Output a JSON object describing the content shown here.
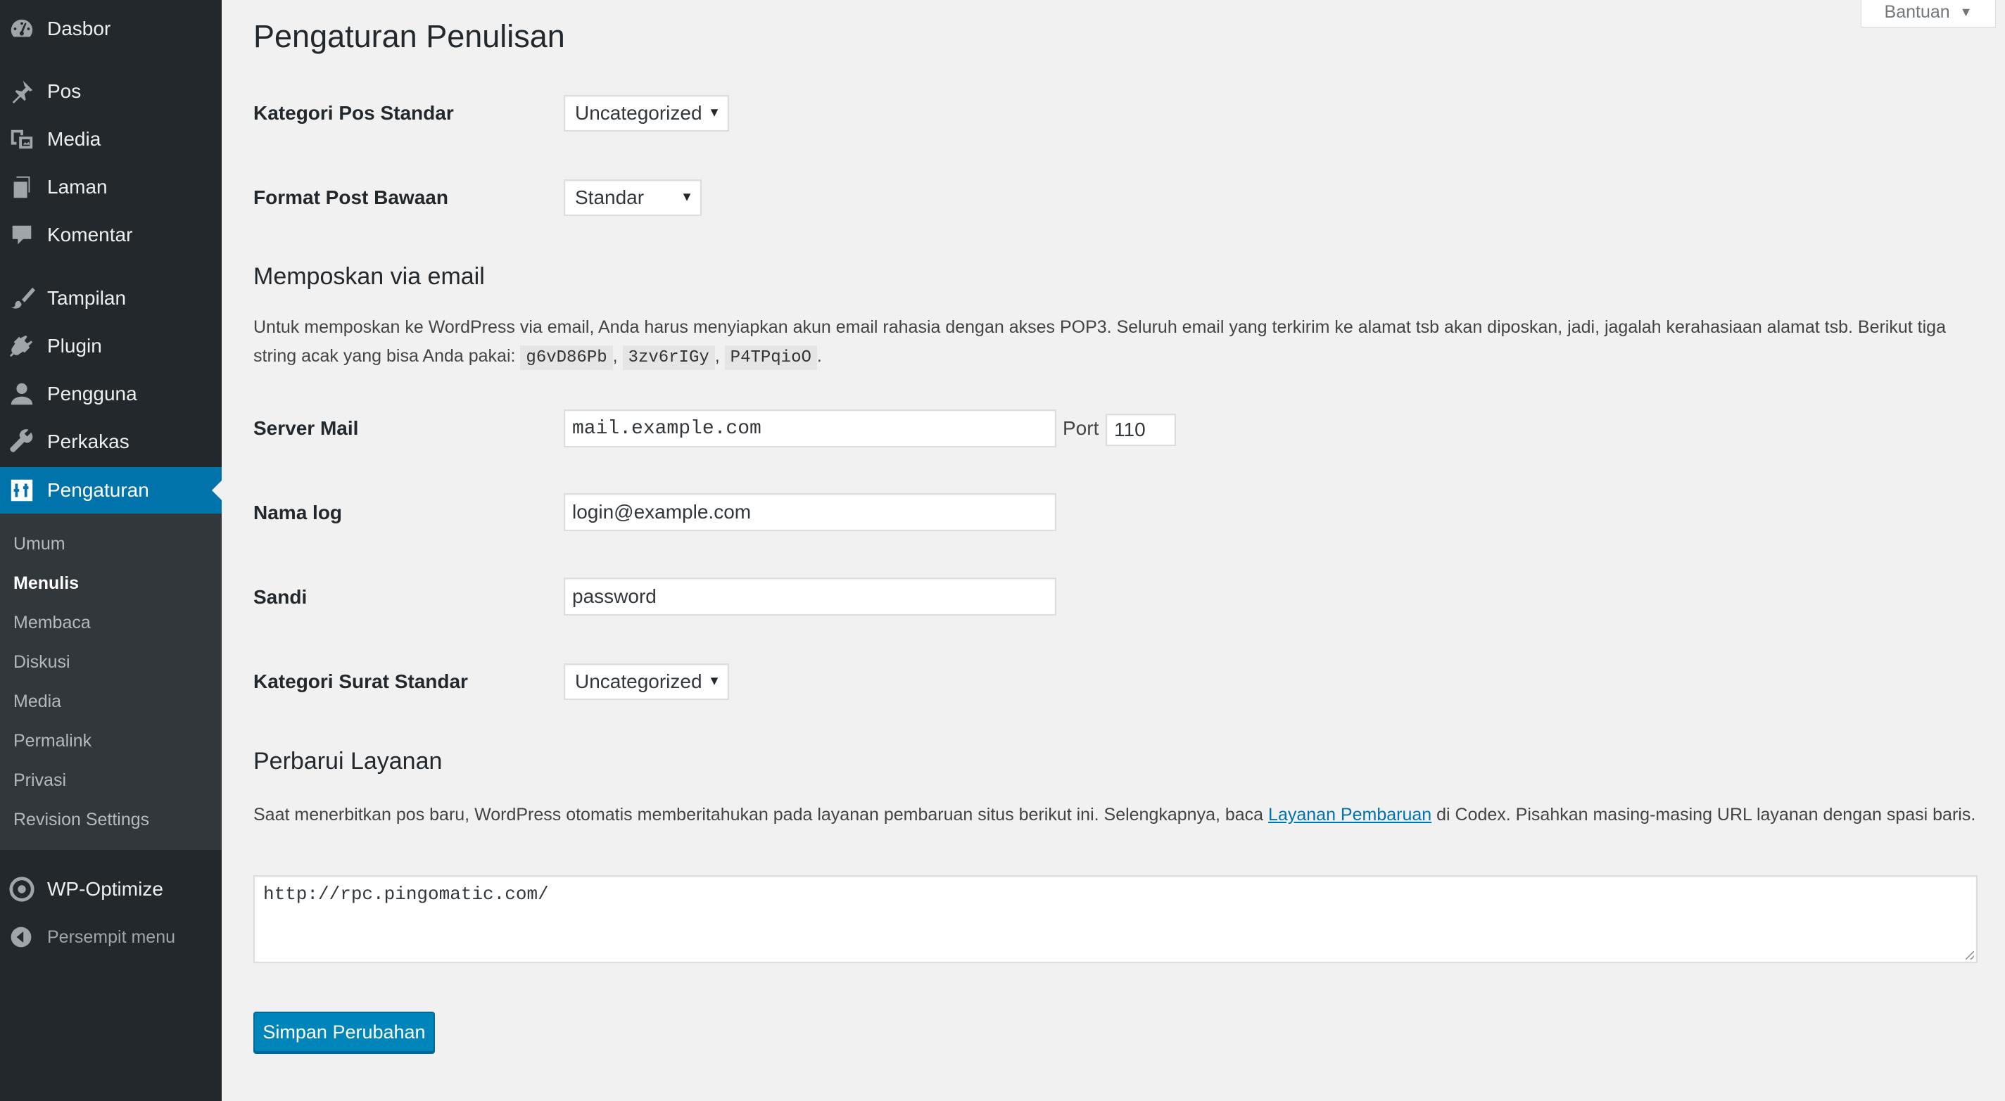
{
  "menu": {
    "items": [
      {
        "label": "Dasbor",
        "icon": "dashboard-icon"
      },
      {
        "label": "Pos",
        "icon": "pin-icon"
      },
      {
        "label": "Media",
        "icon": "media-icon"
      },
      {
        "label": "Laman",
        "icon": "pages-icon"
      },
      {
        "label": "Komentar",
        "icon": "comment-icon"
      },
      {
        "label": "Tampilan",
        "icon": "appearance-brush-icon"
      },
      {
        "label": "Plugin",
        "icon": "plugin-icon"
      },
      {
        "label": "Pengguna",
        "icon": "user-icon"
      },
      {
        "label": "Perkakas",
        "icon": "wrench-icon"
      },
      {
        "label": "Pengaturan",
        "icon": "settings-sliders-icon",
        "current": true
      }
    ],
    "submenu": [
      {
        "label": "Umum"
      },
      {
        "label": "Menulis",
        "current": true
      },
      {
        "label": "Membaca"
      },
      {
        "label": "Diskusi"
      },
      {
        "label": "Media"
      },
      {
        "label": "Permalink"
      },
      {
        "label": "Privasi"
      },
      {
        "label": "Revision Settings"
      }
    ],
    "wp_optimize": {
      "label": "WP-Optimize",
      "icon": "wp-optimize-icon"
    },
    "collapse": {
      "label": "Persempit menu",
      "icon": "collapse-arrow-icon"
    }
  },
  "help_tab": {
    "label": "Bantuan"
  },
  "page": {
    "title": "Pengaturan Penulisan",
    "default_category": {
      "label": "Kategori Pos Standar",
      "value": "Uncategorized"
    },
    "default_post_format": {
      "label": "Format Post Bawaan",
      "value": "Standar"
    },
    "post_via_email": {
      "title": "Memposkan via email",
      "desc_part1": "Untuk memposkan ke WordPress via email, Anda harus menyiapkan akun email rahasia dengan akses POP3. Seluruh email yang terkirim ke alamat tsb akan diposkan, jadi, jagalah kerahasiaan alamat tsb. Berikut tiga string acak yang bisa Anda pakai:",
      "codes": [
        "g6vD86Pb",
        "3zv6rIGy",
        "P4TPqioO"
      ],
      "sep": ",",
      "end": ".",
      "mail_server": {
        "label": "Server Mail",
        "value": "mail.example.com"
      },
      "port": {
        "label": "Port",
        "value": "110"
      },
      "login": {
        "label": "Nama log",
        "value": "login@example.com"
      },
      "password": {
        "label": "Sandi",
        "value": "password"
      },
      "mail_category": {
        "label": "Kategori Surat Standar",
        "value": "Uncategorized"
      }
    },
    "update_services": {
      "title": "Perbarui Layanan",
      "desc_part1": "Saat menerbitkan pos baru, WordPress otomatis memberitahukan pada layanan pembaruan situs berikut ini. Selengkapnya, baca",
      "link_text": "Layanan Pembaruan",
      "desc_part2": "di Codex. Pisahkan masing-masing URL layanan dengan spasi baris.",
      "textarea_value": "http://rpc.pingomatic.com/"
    },
    "save_label": "Simpan Perubahan"
  },
  "colors": {
    "sidebar_bg": "#23282d",
    "submenu_bg": "#32373c",
    "accent": "#0073aa",
    "button": "#0085ba",
    "page_bg": "#f1f1f1"
  }
}
